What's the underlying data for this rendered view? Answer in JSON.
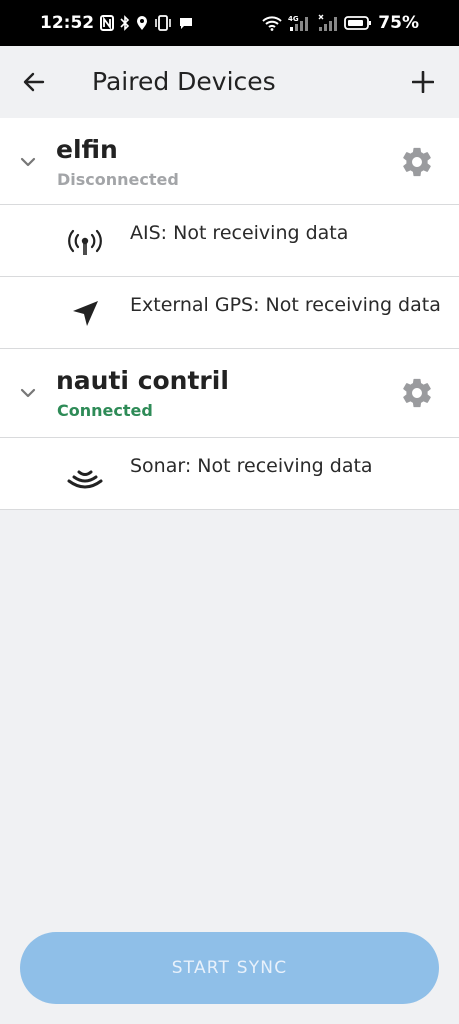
{
  "status_bar": {
    "time": "12:52",
    "battery": "75%",
    "icons": [
      "nfc-icon",
      "bluetooth-icon",
      "location-icon",
      "vibrate-icon",
      "chat-bubble-icon",
      "wifi-icon",
      "signal-4g-icon",
      "signal-no-service-icon",
      "battery-icon"
    ]
  },
  "app_bar": {
    "title": "Paired Devices",
    "back_icon": "arrow-left-icon",
    "add_icon": "plus-icon"
  },
  "devices": [
    {
      "name": "elfin",
      "status": "Disconnected",
      "status_color": "#a3a5a8",
      "sensors": [
        {
          "label": "AIS: Not receiving data",
          "icon": "antenna-broadcast-icon"
        },
        {
          "label": "External GPS: Not receiving data",
          "icon": "navigation-arrow-icon"
        }
      ]
    },
    {
      "name": "nauti contril",
      "status": "Connected",
      "status_color": "#2e8b57",
      "sensors": [
        {
          "label": "Sonar: Not receiving data",
          "icon": "sonar-waves-icon"
        }
      ]
    }
  ],
  "sync_button": {
    "label": "START SYNC",
    "color": "#8fbfe8"
  },
  "colors": {
    "background": "#f0f1f3",
    "card": "#ffffff",
    "divider": "#d9dadc",
    "gear": "#9a9b9e"
  }
}
